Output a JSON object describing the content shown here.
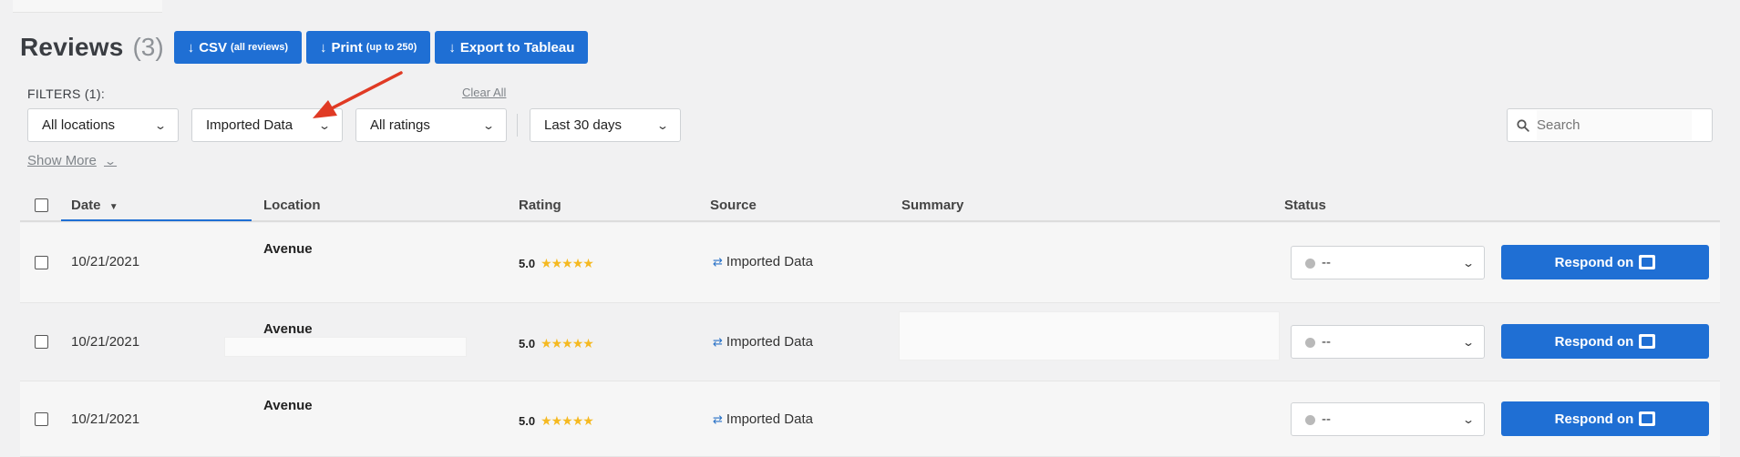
{
  "header": {
    "title": "Reviews",
    "count": "(3)",
    "buttons": [
      {
        "label": "CSV",
        "sub": "(all reviews)"
      },
      {
        "label": "Print",
        "sub": "(up to 250)"
      },
      {
        "label": "Export to Tableau",
        "sub": ""
      }
    ]
  },
  "filters": {
    "label": "FILTERS (1):",
    "clear_all": "Clear All",
    "locations": "All locations",
    "source": "Imported Data",
    "ratings": "All ratings",
    "date_range": "Last 30 days",
    "search_placeholder": "Search",
    "show_more": "Show More"
  },
  "table": {
    "columns": [
      "Date",
      "Location",
      "Rating",
      "Source",
      "Summary",
      "Status"
    ],
    "rows": [
      {
        "date": "10/21/2021",
        "location": "Avenue",
        "rating": "5.0",
        "stars": "★★★★★",
        "source": "Imported Data",
        "status": "--",
        "respond": "Respond on"
      },
      {
        "date": "10/21/2021",
        "location": "Avenue",
        "rating": "5.0",
        "stars": "★★★★★",
        "source": "Imported Data",
        "status": "--",
        "respond": "Respond on"
      },
      {
        "date": "10/21/2021",
        "location": "Avenue",
        "rating": "5.0",
        "stars": "★★★★★",
        "source": "Imported Data",
        "status": "--",
        "respond": "Respond on"
      }
    ]
  },
  "icons": {
    "arrow_down": "↓",
    "chevron": "⌄",
    "search": "search-icon",
    "source": "imported-data-icon"
  },
  "colors": {
    "accent": "#1f6fd4",
    "star": "#f5b921",
    "annotation_arrow": "#e03a24"
  }
}
